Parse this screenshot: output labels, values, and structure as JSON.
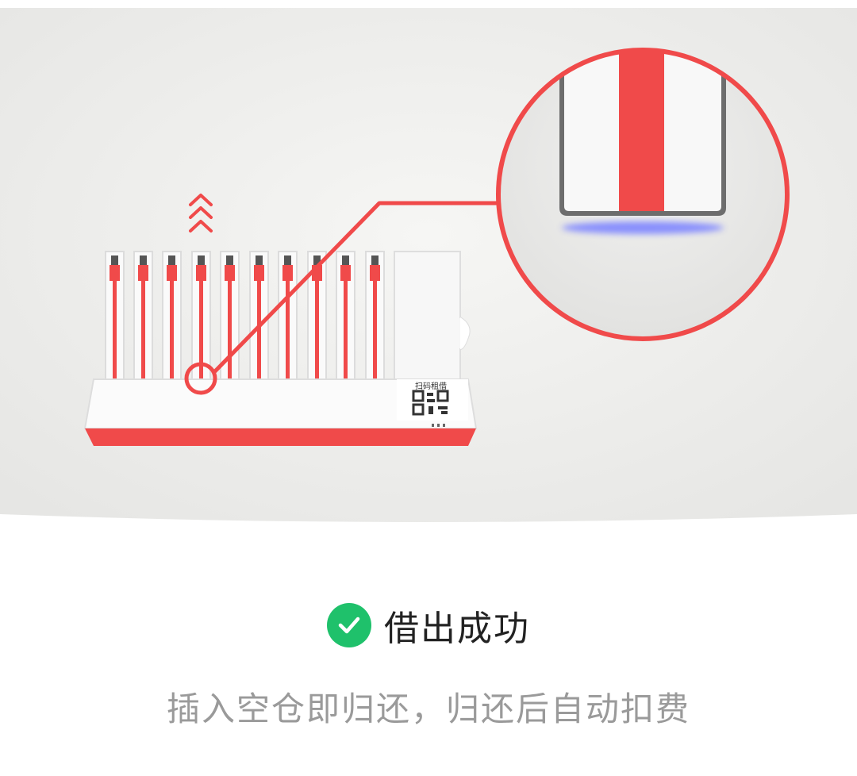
{
  "status": {
    "title": "借出成功",
    "icon": "check-circle-icon",
    "icon_color": "#1fc16b"
  },
  "hint": {
    "text": "插入空仓即归还，归还后自动扣费"
  },
  "illustration": {
    "station_label": "扫码租借",
    "colors": {
      "accent": "#f04a4a",
      "background": "#efefef",
      "led": "#7f86ff"
    }
  }
}
